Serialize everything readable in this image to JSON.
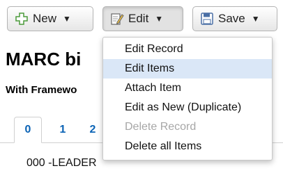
{
  "toolbar": {
    "new_label": "New",
    "edit_label": "Edit",
    "save_label": "Save"
  },
  "page": {
    "title": "MARC bi",
    "subtitle": "With Framewo",
    "leader": "000 -LEADER"
  },
  "tabs": [
    "0",
    "1",
    "2"
  ],
  "edit_menu": {
    "items": [
      {
        "label": "Edit Record",
        "state": "normal"
      },
      {
        "label": "Edit Items",
        "state": "highlighted"
      },
      {
        "label": "Attach Item",
        "state": "normal"
      },
      {
        "label": "Edit as New (Duplicate)",
        "state": "normal"
      },
      {
        "label": "Delete Record",
        "state": "disabled"
      },
      {
        "label": "Delete all Items",
        "state": "normal"
      }
    ]
  },
  "icons": {
    "new": "plus-icon",
    "edit": "edit-document-icon",
    "save": "floppy-disk-icon",
    "caret": "caret-down-icon"
  },
  "colors": {
    "link_blue": "#0b63b5",
    "menu_highlight": "#dae7f7",
    "disabled_text": "#a7a7a7"
  }
}
